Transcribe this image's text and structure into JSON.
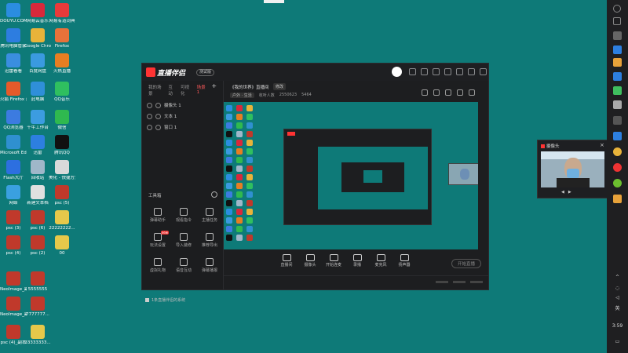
{
  "desktop": {
    "icons": [
      {
        "label": "DOUYU.COM 斗鱼直播",
        "color": "#2b8de0"
      },
      {
        "label": "网易云音乐",
        "color": "#d9283b"
      },
      {
        "label": "网易有道词典",
        "color": "#e63a3a"
      },
      {
        "label": "腾讯电脑管家",
        "color": "#2d7de0"
      },
      {
        "label": "Google Chrome",
        "color": "#e8b33a"
      },
      {
        "label": "Firefox",
        "color": "#e8723a"
      },
      {
        "label": "迅雷看看",
        "color": "#3a8ee0"
      },
      {
        "label": "百度网盘",
        "color": "#3a9ae0"
      },
      {
        "label": "火热直播",
        "color": "#e67e22"
      },
      {
        "label": "火狐 Firefox 浏览",
        "color": "#e55a2a"
      },
      {
        "label": "此电脑",
        "color": "#2f8fd9"
      },
      {
        "label": "QQ音乐",
        "color": "#2fbf5f"
      },
      {
        "label": "QQ浏览器",
        "color": "#3c7be0"
      },
      {
        "label": "千牛工作台",
        "color": "#3c9ce0"
      },
      {
        "label": "微信",
        "color": "#2fb94f"
      },
      {
        "label": "Microsoft Edge",
        "color": "#2f90d0"
      },
      {
        "label": "迅雷",
        "color": "#2d7fe0"
      },
      {
        "label": "腾讯QQ",
        "color": "#111111"
      },
      {
        "label": "Flash大厅",
        "color": "#2d6fe0"
      },
      {
        "label": "回收站",
        "color": "#9fb7c9"
      },
      {
        "label": "美化 - 快捷方式",
        "color": "#d9d9d9"
      },
      {
        "label": "网络",
        "color": "#3aa0e0"
      },
      {
        "label": "新建文本档",
        "color": "#e0e0e0"
      },
      {
        "label": "psc (5)",
        "color": "#c0392b"
      },
      {
        "label": "psc (3)",
        "color": "#c0392b"
      },
      {
        "label": "psc (6)",
        "color": "#c0392b"
      },
      {
        "label": "22222222...",
        "color": "#e6c84a"
      },
      {
        "label": "psc (4)",
        "color": "#c0392b"
      },
      {
        "label": "psc (2)",
        "color": "#c0392b"
      },
      {
        "label": "00",
        "color": "#e6c84a"
      },
      {
        "label": "NeoImage_副本",
        "color": "#c0392b"
      },
      {
        "label": "5555555",
        "color": "#c0392b"
      },
      {
        "label": "NeoImage_副本_副本",
        "color": "#c0392b"
      },
      {
        "label": "7777777...",
        "color": "#c0392b"
      },
      {
        "label": "psc (4)_副本",
        "color": "#c0392b"
      },
      {
        "label": "33333333...",
        "color": "#e6c84a"
      }
    ]
  },
  "app": {
    "title": "直播伴侣",
    "version": "测试版",
    "scene_tabs": [
      "我的场景",
      "互动",
      "可视化",
      "场景1"
    ],
    "active_tab": "场景1",
    "sources": [
      "摄像头 1",
      "文本 1",
      "窗口 1"
    ],
    "tools_title": "工具箱",
    "tools": [
      {
        "label": "弹幕助手",
        "new": false
      },
      {
        "label": "观看指令",
        "new": false
      },
      {
        "label": "主播任务",
        "new": false
      },
      {
        "label": "玩法设置",
        "new": true
      },
      {
        "label": "导入装修",
        "new": false
      },
      {
        "label": "推荐导出",
        "new": false
      },
      {
        "label": "虚拟礼物",
        "new": false
      },
      {
        "label": "语音互动",
        "new": false
      },
      {
        "label": "弹幕播报",
        "new": false
      }
    ],
    "notice": "1条直播伴侣的系统",
    "room_title": "《我的世界》直播间",
    "modify_label": "修改",
    "room_category": "户外 · 生活",
    "room_label": "收听人数",
    "room_id": "2550623",
    "room_fans": "5464",
    "bottom_actions": [
      "直播间",
      "摄像头",
      "开始连麦",
      "录播",
      "麦克风",
      "扬声器"
    ],
    "start_button": "开始直播"
  },
  "camera_preview": {
    "title": "摄像头",
    "controls": [
      "◀",
      "▶"
    ]
  },
  "taskbar": {
    "lang": "英",
    "time": "3:59"
  }
}
